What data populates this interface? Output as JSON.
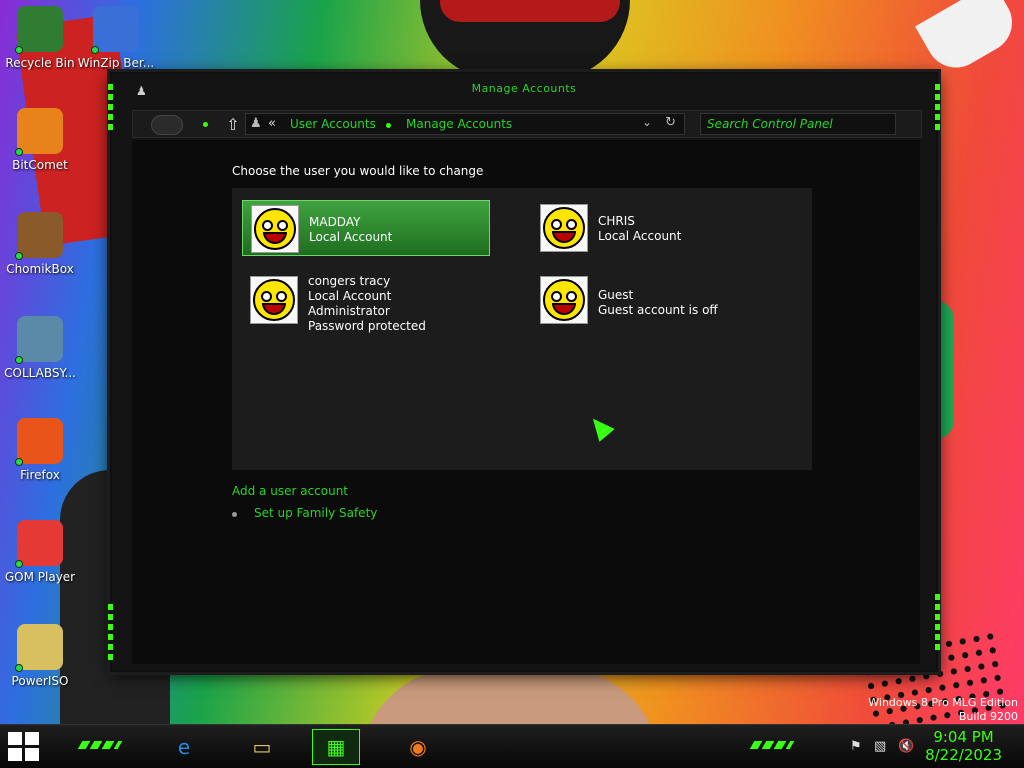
{
  "desktop": {
    "icons": [
      {
        "label": "Recycle Bin",
        "icon": "recycle-bin-icon",
        "color": "#2e7d32"
      },
      {
        "label": "WinZip Ber...",
        "icon": "winzip-icon",
        "color": "#3a6fd8"
      },
      {
        "label": "BitComet",
        "icon": "bitcomet-icon",
        "color": "#e8821a"
      },
      {
        "label": "ChomikBox",
        "icon": "chomikbox-icon",
        "color": "#8a5a2a"
      },
      {
        "label": "COLLABSY...",
        "icon": "document-icon",
        "color": "#5a8aa8"
      },
      {
        "label": "Firefox",
        "icon": "firefox-icon",
        "color": "#e8541a"
      },
      {
        "label": "GOM Player",
        "icon": "gom-player-icon",
        "color": "#e53935"
      },
      {
        "label": "PowerISO",
        "icon": "poweriso-icon",
        "color": "#d8c060"
      }
    ],
    "edition_line1": "Windows 8 Pro MLG Edition",
    "edition_line2": "Build 9200"
  },
  "window": {
    "title": "Manage Accounts",
    "breadcrumb": [
      "User Accounts",
      "Manage Accounts"
    ],
    "breadcrumb_prefix": "«",
    "search_placeholder": "Search Control Panel",
    "heading": "Choose the user you would like to change",
    "accounts": [
      {
        "name": "MADDAY",
        "lines": [
          "Local Account"
        ],
        "selected": true
      },
      {
        "name": "CHRIS",
        "lines": [
          "Local Account"
        ],
        "selected": false
      },
      {
        "name": "congers tracy",
        "lines": [
          "Local Account",
          "Administrator",
          "Password protected"
        ],
        "selected": false
      },
      {
        "name": "Guest",
        "lines": [
          "Guest account is off"
        ],
        "selected": false
      }
    ],
    "add_account_link": "Add a user account",
    "family_safety_link": "Set up Family Safety"
  },
  "taskbar": {
    "apps": [
      {
        "name": "internet-explorer",
        "icon": "internet-explorer-icon",
        "glyph": "e"
      },
      {
        "name": "file-explorer",
        "icon": "folder-icon",
        "glyph": "▭"
      },
      {
        "name": "control-panel",
        "icon": "control-panel-icon",
        "glyph": "▦"
      },
      {
        "name": "firefox",
        "icon": "firefox-icon",
        "glyph": "◉"
      }
    ],
    "time": "9:04 PM",
    "date": "8/22/2023"
  },
  "colors": {
    "accent": "#39ff14",
    "link": "#29d429"
  }
}
